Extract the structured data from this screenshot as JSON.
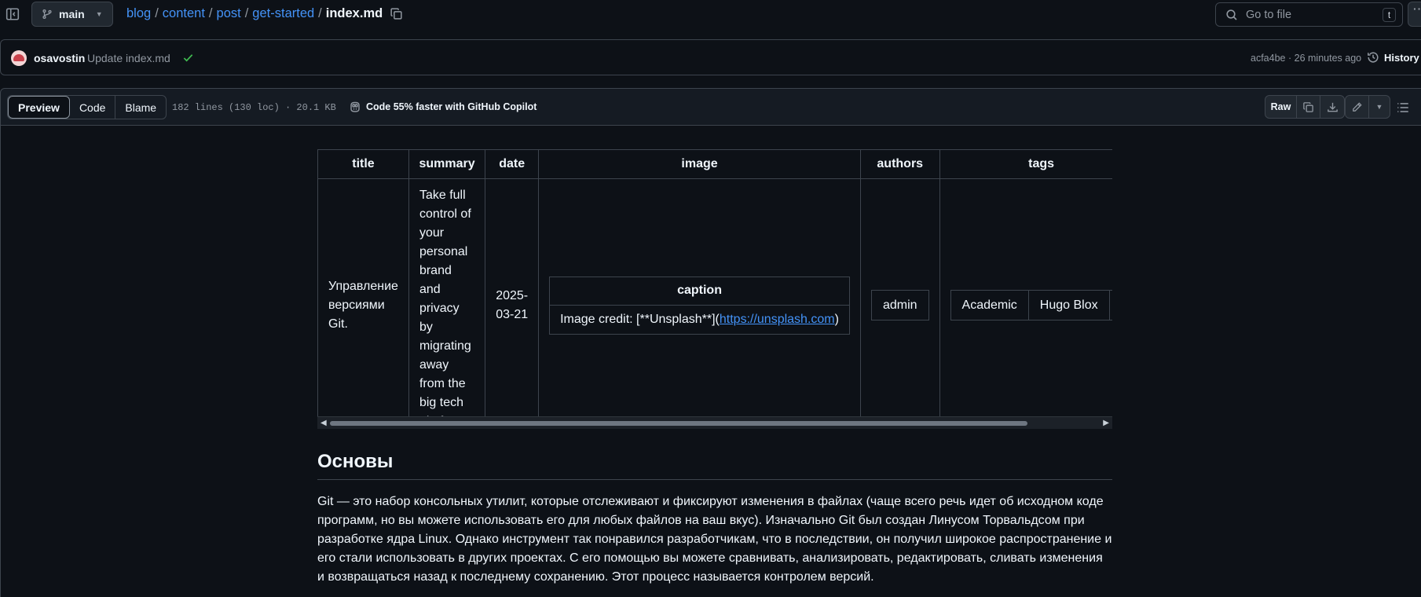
{
  "breadcrumb": {
    "branch": "main",
    "parts": [
      "blog",
      "content",
      "post",
      "get-started"
    ],
    "separator": "/",
    "file": "index.md"
  },
  "search": {
    "placeholder": "Go to file",
    "shortcut": "t"
  },
  "commit": {
    "author": "osavostin",
    "message": "Update index.md",
    "hash": "acfa4be",
    "time": "26 minutes ago",
    "meta_separator": "·",
    "history_label": "History"
  },
  "file_header": {
    "tabs": [
      "Preview",
      "Code",
      "Blame"
    ],
    "active_tab": "Preview",
    "stats": "182 lines (130 loc) · 20.1 KB",
    "copilot": "Code 55% faster with GitHub Copilot",
    "raw_label": "Raw"
  },
  "frontmatter": {
    "headers": [
      "title",
      "summary",
      "date",
      "image",
      "authors",
      "tags"
    ],
    "title": "Управление версиями Git.",
    "summary": "Take full control of your personal brand and privacy by migrating away from the big tech platforms!",
    "date": "2025-03-21",
    "image": {
      "header": "caption",
      "prefix": "Image credit: [**Unsplash**](",
      "link": "https://unsplash.com",
      "suffix": ")"
    },
    "authors": [
      "admin"
    ],
    "tags": [
      "Academic",
      "Hugo Blox"
    ]
  },
  "article": {
    "heading": "Основы",
    "paragraph": "Git — это набор консольных утилит, которые отслеживают и фиксируют изменения в файлах (чаще всего речь идет об исходном коде программ, но вы можете использовать его для любых файлов на ваш вкус). Изначально Git был создан Линусом Торвальдсом при разработке ядра Linux. Однако инструмент так понравился разработчикам, что в последствии, он получил широкое распространение и его стали использовать в других проектах. С его помощью вы можете сравнивать, анализировать, редактировать, сливать изменения и возвращаться назад к последнему сохранению. Этот процесс называется контролем версий."
  },
  "icons": {
    "sidebar": "sidebar-toggle-icon",
    "branch": "git-branch-icon",
    "copy": "copy-icon",
    "search": "search-icon",
    "check": "check-icon",
    "history": "history-icon",
    "copilot": "copilot-icon",
    "download": "download-icon",
    "pencil": "pencil-icon",
    "symbols": "list-icon"
  },
  "colors": {
    "background": "#0d1117",
    "link": "#4493f8",
    "success": "#3fb950",
    "border": "#3d444d"
  }
}
